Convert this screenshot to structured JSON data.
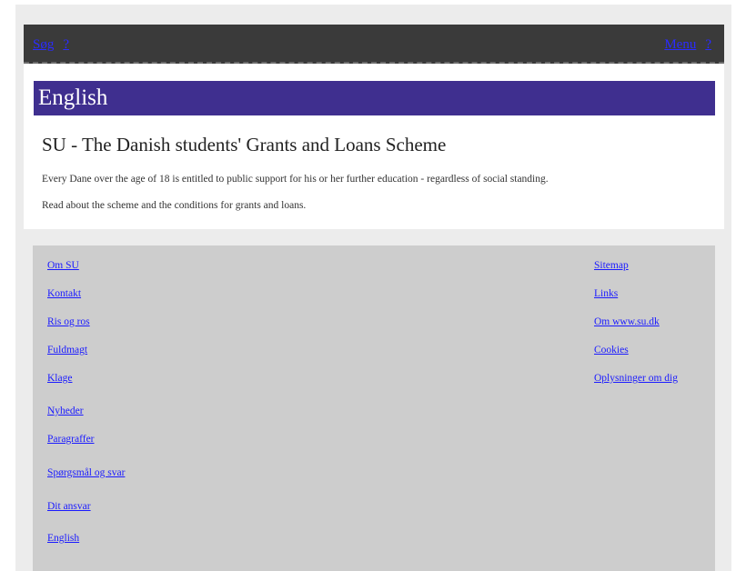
{
  "topbar": {
    "left_link": "Søg",
    "left_icon": "?",
    "right_link": "Menu",
    "right_icon": "?"
  },
  "banner": {
    "title": "English"
  },
  "main": {
    "heading": "SU - The Danish students' Grants and Loans Scheme",
    "paragraph1": "Every Dane over the age of 18 is entitled to public support for his or her further education - regardless of social standing.",
    "paragraph2": "Read about the scheme and the conditions for grants and loans."
  },
  "footer": {
    "left_links": [
      "Om SU",
      "Kontakt",
      "Ris og ros",
      "Fuldmagt",
      "Klage",
      "Nyheder",
      "Paragraffer",
      "Spørgsmål og svar",
      "Dit ansvar",
      "English"
    ],
    "right_links": [
      "Sitemap",
      "Links",
      "Om www.su.dk",
      "Cookies",
      "Oplysninger om dig"
    ]
  }
}
